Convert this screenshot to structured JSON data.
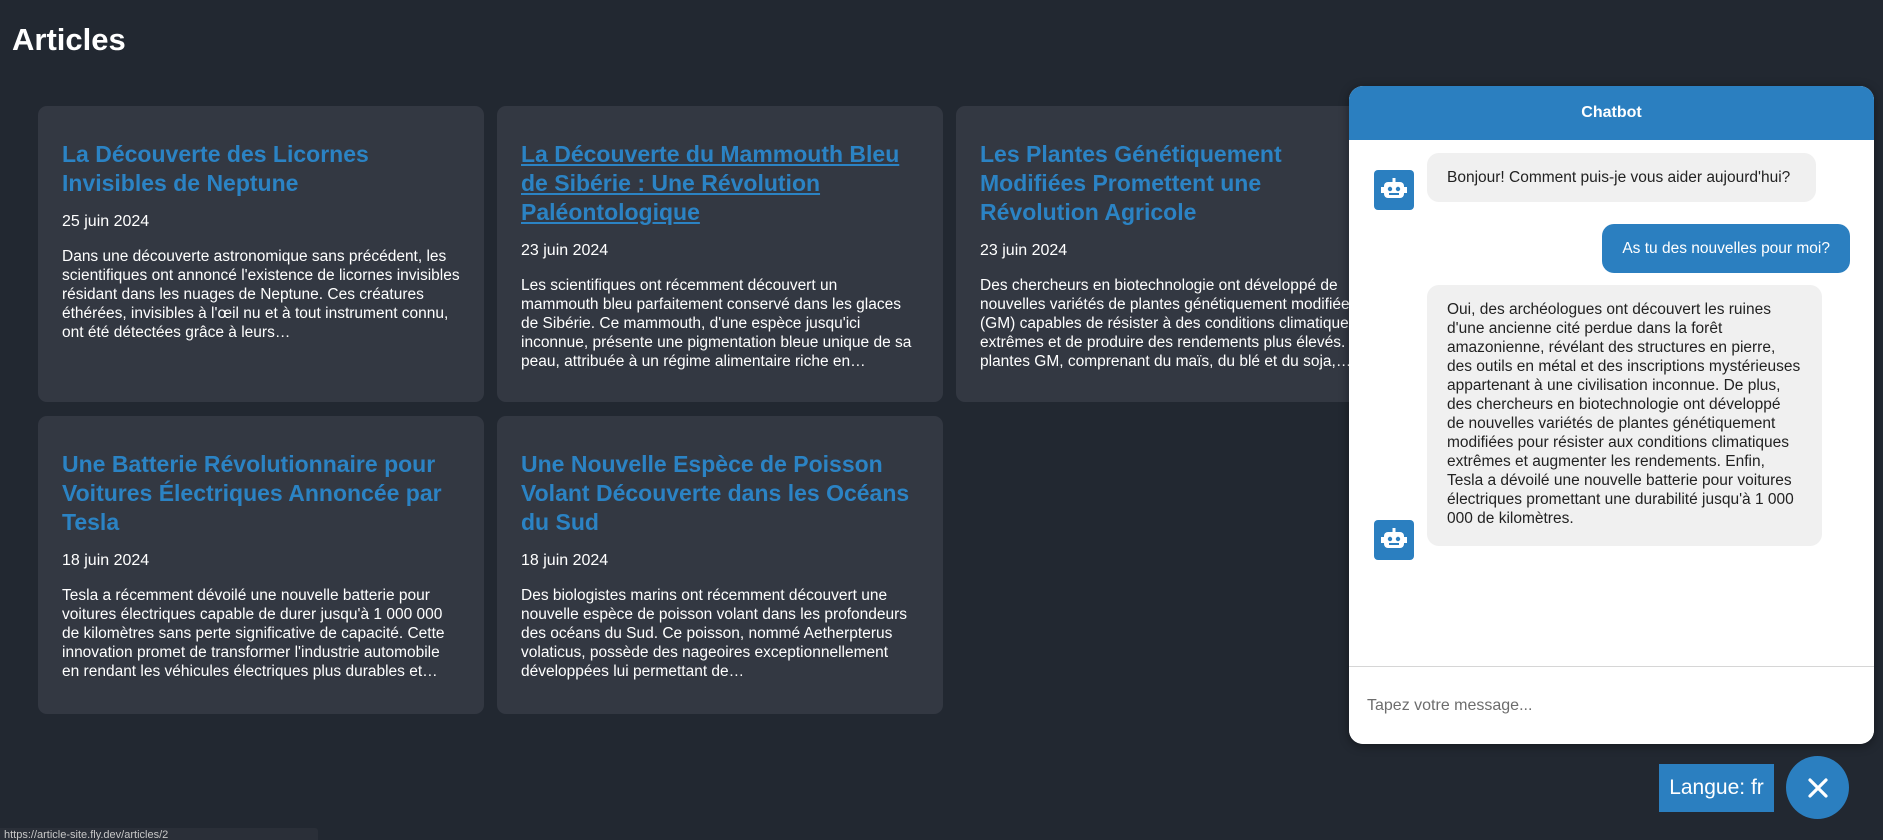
{
  "page": {
    "title": "Articles"
  },
  "articles": [
    {
      "title": "La Découverte des Licornes Invisibles de Neptune",
      "date": "25 juin 2024",
      "excerpt": "Dans une découverte astronomique sans précédent, les scientifiques ont annoncé l'existence de licornes invisibles résidant dans les nuages de Neptune. Ces créatures éthérées, invisibles à l'œil nu et à tout instrument connu, ont été détectées grâce à leurs…"
    },
    {
      "title": "La Découverte du Mammouth Bleu de Sibérie : Une Révolution Paléontologique",
      "date": "23 juin 2024",
      "excerpt": "Les scientifiques ont récemment découvert un mammouth bleu parfaitement conservé dans les glaces de Sibérie. Ce mammouth, d'une espèce jusqu'ici inconnue, présente une pigmentation bleue unique de sa peau, attribuée à un régime alimentaire riche en…"
    },
    {
      "title": "Les Plantes Génétiquement Modifiées Promettent une Révolution Agricole",
      "date": "23 juin 2024",
      "excerpt": "Des chercheurs en biotechnologie ont développé de nouvelles variétés de plantes génétiquement modifiées (GM) capables de résister à des conditions climatiques extrêmes et de produire des rendements plus élevés. Ces plantes GM, comprenant du maïs, du blé et du soja,…"
    },
    {
      "title": "Une Batterie Révolutionnaire pour Voitures Électriques Annoncée par Tesla",
      "date": "18 juin 2024",
      "excerpt": "Tesla a récemment dévoilé une nouvelle batterie pour voitures électriques capable de durer jusqu'à 1 000 000 de kilomètres sans perte significative de capacité. Cette innovation promet de transformer l'industrie automobile en rendant les véhicules électriques plus durables et…"
    },
    {
      "title": "Une Nouvelle Espèce de Poisson Volant Découverte dans les Océans du Sud",
      "date": "18 juin 2024",
      "excerpt": "Des biologistes marins ont récemment découvert une nouvelle espèce de poisson volant dans les profondeurs des océans du Sud. Ce poisson, nommé Aetherpterus volaticus, possède des nageoires exceptionnellement développées lui permettant de…"
    }
  ],
  "chatbot": {
    "header": "Chatbot",
    "messages": [
      {
        "from": "bot",
        "text": "Bonjour! Comment puis-je vous aider aujourd'hui?"
      },
      {
        "from": "user",
        "text": "As tu des nouvelles pour moi?"
      },
      {
        "from": "bot",
        "text": "Oui, des archéologues ont découvert les ruines d'une ancienne cité perdue dans la forêt amazonienne, révélant des structures en pierre, des outils en métal et des inscriptions mystérieuses appartenant à une civilisation inconnue. De plus, des chercheurs en biotechnologie ont développé de nouvelles variétés de plantes génétiquement modifiées pour résister aux conditions climatiques extrêmes et augmenter les rendements. Enfin, Tesla a dévoilé une nouvelle batterie pour voitures électriques promettant une durabilité jusqu'à 1 000 000 de kilomètres."
      }
    ],
    "input": {
      "value": "",
      "placeholder": "Tapez votre message..."
    }
  },
  "controls": {
    "language_button": "Langue: fr",
    "close_icon": "close-icon"
  },
  "status_bar": {
    "url": "https://article-site.fly.dev/articles/2"
  },
  "colors": {
    "background": "#222831",
    "card": "#333842",
    "accent": "#2b7fc0",
    "link": "#2b83c4"
  }
}
